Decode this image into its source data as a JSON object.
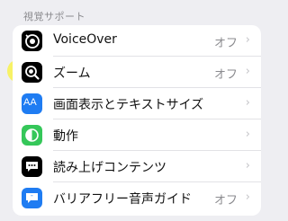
{
  "section": {
    "header": "視覚サポート"
  },
  "rows": [
    {
      "label": "VoiceOver",
      "value": "オフ",
      "icon": "voiceover-icon",
      "icon_color": "#000000",
      "highlighted": false
    },
    {
      "label": "ズーム",
      "value": "オフ",
      "icon": "zoom-icon",
      "icon_color": "#000000",
      "highlighted": true
    },
    {
      "label": "画面表示とテキストサイズ",
      "value": "",
      "icon": "text-size-icon",
      "icon_color": "#1f7cf2",
      "highlighted": false
    },
    {
      "label": "動作",
      "value": "",
      "icon": "motion-icon",
      "icon_color": "#35c759",
      "highlighted": false
    },
    {
      "label": "読み上げコンテンツ",
      "value": "",
      "icon": "spoken-content-icon",
      "icon_color": "#000000",
      "highlighted": false
    },
    {
      "label": "バリアフリー音声ガイド",
      "value": "オフ",
      "icon": "audio-descriptions-icon",
      "icon_color": "#1f7cf2",
      "highlighted": false
    }
  ],
  "chevron": "›",
  "icon_glyphs": {
    "text_size": "AA"
  },
  "colors": {
    "highlight": "#f7f256",
    "background": "#eeeef2"
  }
}
